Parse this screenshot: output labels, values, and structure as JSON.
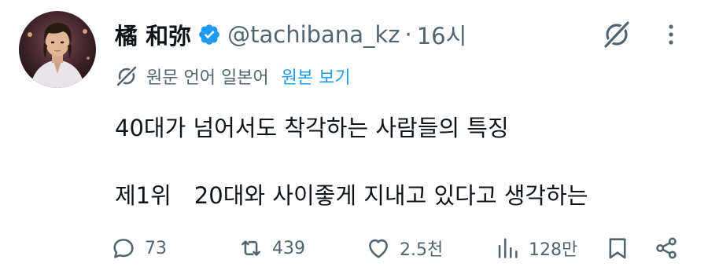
{
  "tweet": {
    "author": {
      "display_name": "橘 和弥",
      "handle": "@tachibana_kz",
      "separator": "·",
      "time": "16시",
      "verified": true
    },
    "translation": {
      "notice": "원문 언어 일본어",
      "show_original": "원본 보기"
    },
    "body": {
      "line1": "40대가 넘어서도 착각하는 사람들의 특징",
      "line2": "제1위　20대와 사이좋게 지내고 있다고 생각하는"
    },
    "metrics": {
      "replies": "73",
      "reposts": "439",
      "likes": "2.5천",
      "views": "128만"
    }
  },
  "icons": {
    "verified": "verified-badge-icon",
    "grok": "grok-icon",
    "more": "more-vertical-icon",
    "translate": "grok-translate-icon",
    "reply": "reply-icon",
    "repost": "repost-icon",
    "like": "heart-icon",
    "views": "views-bar-icon",
    "bookmark": "bookmark-icon",
    "share": "share-icon"
  },
  "colors": {
    "text": "#0f1419",
    "secondary": "#536471",
    "link": "#1d9bf0",
    "verified": "#1d9bf0"
  }
}
